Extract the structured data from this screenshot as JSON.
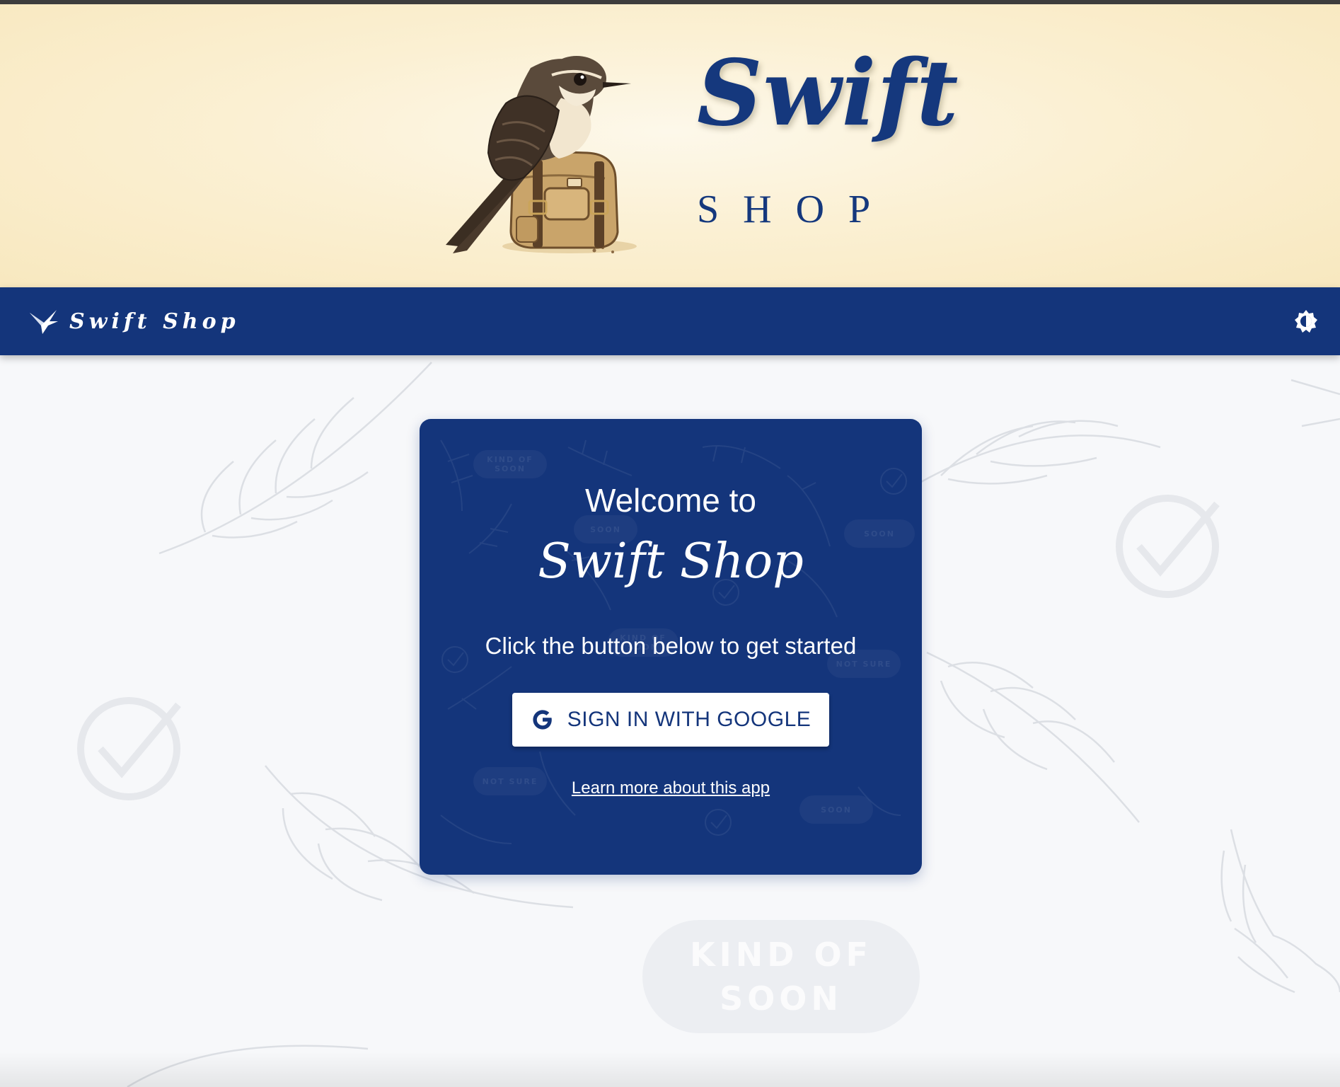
{
  "hero": {
    "title": "Swift",
    "subtitle": "SHOP",
    "image_name": "swift-with-backpack"
  },
  "navbar": {
    "brand_name": "Swift Shop",
    "brand_icon": "swift-bird-icon",
    "theme_toggle_icon": "brightness-icon"
  },
  "background": {
    "badge_text": "KIND OF\nSOON"
  },
  "card": {
    "welcome": "Welcome to",
    "title": "Swift Shop",
    "instructions": "Click the button below to get started",
    "sign_in_label": "SIGN IN WITH GOOGLE",
    "learn_more": "Learn more about this app",
    "pattern_badges": [
      "KIND OF\nSOON",
      "SOON",
      "SOON",
      "KIND OF\nSOON",
      "NOT SURE",
      "NOT SURE",
      "SOON"
    ]
  },
  "colors": {
    "primary": "#14357b",
    "banner": "#fbf0d3",
    "page_background": "#f7f8fa",
    "button_background": "#ffffff"
  }
}
